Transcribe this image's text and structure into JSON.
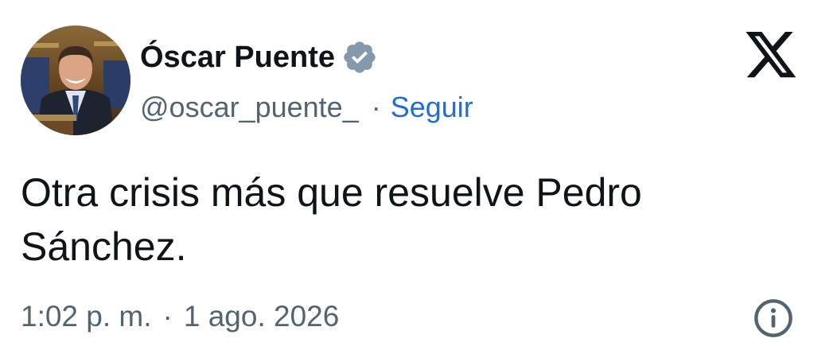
{
  "author": {
    "display_name": "Óscar Puente",
    "handle": "@oscar_puente_",
    "verified_badge_icon": "verified-badge-icon",
    "avatar_icon": "profile-photo"
  },
  "follow": {
    "separator": "·",
    "label": "Seguir",
    "color": "#1d6fd1"
  },
  "brand": {
    "logo_icon": "x-logo-icon"
  },
  "tweet": {
    "text": "Otra crisis más que resuelve Pedro Sánchez."
  },
  "meta": {
    "time": "1:02 p. m.",
    "separator": "·",
    "date": "1 ago. 2026",
    "info_icon": "info-icon"
  },
  "colors": {
    "text": "#0f1419",
    "secondary": "#536471",
    "badge": "#829aab"
  }
}
